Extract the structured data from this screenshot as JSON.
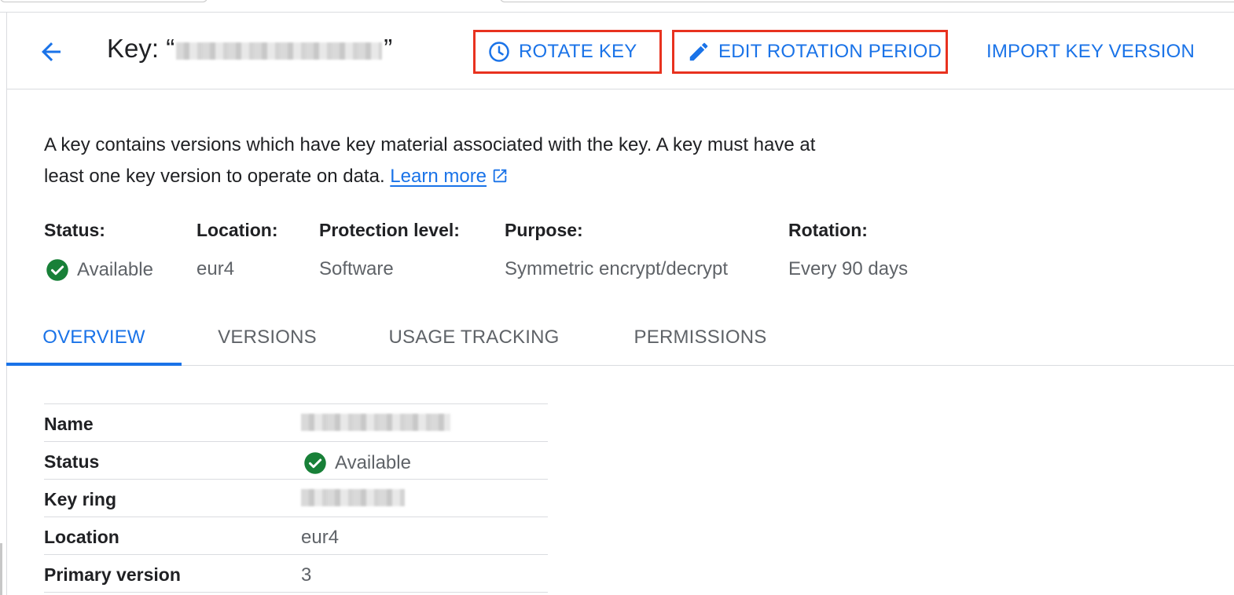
{
  "header": {
    "title_prefix": "Key: “",
    "title_suffix": "”",
    "back_icon": "arrow-back-icon",
    "actions": {
      "rotate_key": "ROTATE KEY",
      "edit_rotation_period": "EDIT ROTATION PERIOD",
      "import_key_version": "IMPORT KEY VERSION"
    },
    "highlight_color": "#e8321f",
    "accent_color": "#1a73e8"
  },
  "description": {
    "text": "A key contains versions which have key material associated with the key. A key must have at least one key version to operate on data.",
    "link": "Learn more"
  },
  "properties": [
    {
      "label": "Status:",
      "value": "Available",
      "icon": "check-circle-icon"
    },
    {
      "label": "Location:",
      "value": "eur4"
    },
    {
      "label": "Protection level:",
      "value": "Software"
    },
    {
      "label": "Purpose:",
      "value": "Symmetric encrypt/decrypt"
    },
    {
      "label": "Rotation:",
      "value": "Every 90 days"
    }
  ],
  "tabs": [
    {
      "label": "OVERVIEW",
      "active": true
    },
    {
      "label": "VERSIONS",
      "active": false
    },
    {
      "label": "USAGE TRACKING",
      "active": false
    },
    {
      "label": "PERMISSIONS",
      "active": false
    }
  ],
  "details": [
    {
      "label": "Name",
      "value": null,
      "redacted": true
    },
    {
      "label": "Status",
      "value": "Available",
      "icon": "check-circle-icon"
    },
    {
      "label": "Key ring",
      "value": null,
      "redacted": true
    },
    {
      "label": "Location",
      "value": "eur4"
    },
    {
      "label": "Primary version",
      "value": "3"
    }
  ],
  "status_color": "#188038"
}
